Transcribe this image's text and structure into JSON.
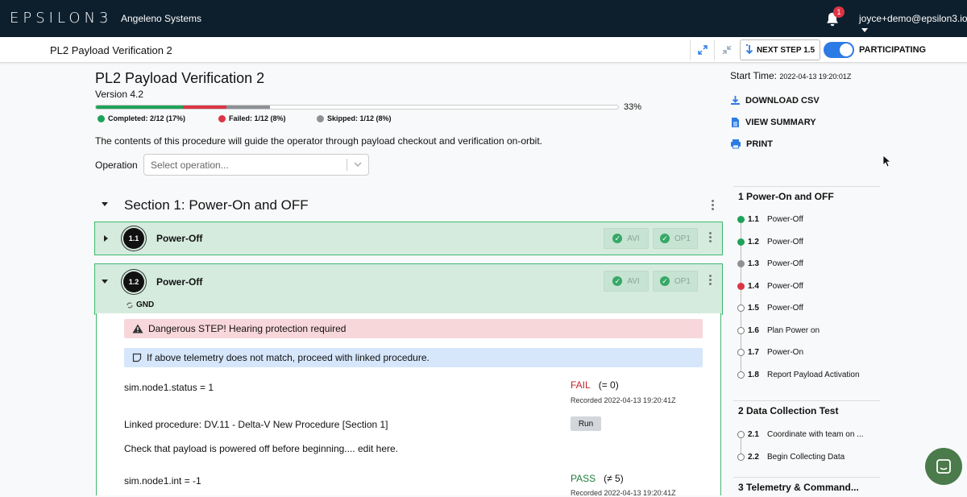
{
  "topbar": {
    "logo": "EPSILON3",
    "org": "Angeleno Systems",
    "notification_count": "1",
    "user": "joyce+demo@epsilon3.io"
  },
  "subbar": {
    "title": "PL2 Payload Verification 2",
    "next_step_label": "NEXT STEP 1.5",
    "participating_label": "PARTICIPATING"
  },
  "procedure": {
    "title": "PL2 Payload Verification 2",
    "version": "Version 4.2",
    "progress": {
      "completed": 2,
      "failed": 1,
      "skipped": 1,
      "total": 12,
      "percent_label": "33%",
      "completed_label": "Completed: 2/12 (17%)",
      "failed_label": "Failed: 1/12 (8%)",
      "skipped_label": "Skipped: 1/12 (8%)"
    },
    "description": "The contents of this procedure will guide the operator through payload checkout and verification on-orbit.",
    "operation_label": "Operation",
    "operation_placeholder": "Select operation..."
  },
  "section": {
    "title": "Section 1: Power-On and OFF",
    "steps": [
      {
        "num": "1.1",
        "name": "Power-Off",
        "signoffs": [
          "AVI",
          "OP1"
        ]
      },
      {
        "num": "1.2",
        "name": "Power-Off",
        "signoffs": [
          "AVI",
          "OP1"
        ],
        "tag": "GND"
      }
    ]
  },
  "step_content": {
    "danger_alert": "Dangerous STEP! Hearing protection required",
    "info_alert": "If above telemetry does not match, proceed with linked procedure.",
    "telemetry_1": {
      "label": "sim.node1.status = 1",
      "status": "FAIL",
      "condition": "(= 0)",
      "recorded": "Recorded 2022-04-13 19:20:41Z"
    },
    "linked_procedure": "Linked procedure: DV.11 - Delta-V New Procedure [Section 1]",
    "run_label": "Run",
    "check_text": "Check that payload is powered off before beginning.... edit here.",
    "telemetry_2": {
      "label": "sim.node1.int = -1",
      "status": "PASS",
      "condition": "(≠ 5)",
      "recorded": "Recorded 2022-04-13 19:20:41Z"
    }
  },
  "sidebar": {
    "start_time_label": "Start Time:",
    "start_time_value": "2022-04-13 19:20:01Z",
    "actions": {
      "download": "DOWNLOAD CSV",
      "summary": "VIEW SUMMARY",
      "print": "PRINT"
    },
    "toc": [
      {
        "title": "1 Power-On and OFF",
        "items": [
          {
            "num": "1.1",
            "label": "Power-Off",
            "state": "completed"
          },
          {
            "num": "1.2",
            "label": "Power-Off",
            "state": "completed"
          },
          {
            "num": "1.3",
            "label": "Power-Off",
            "state": "skipped"
          },
          {
            "num": "1.4",
            "label": "Power-Off",
            "state": "failed"
          },
          {
            "num": "1.5",
            "label": "Power-Off",
            "state": "pending"
          },
          {
            "num": "1.6",
            "label": "Plan Power on",
            "state": "pending"
          },
          {
            "num": "1.7",
            "label": "Power-On",
            "state": "pending"
          },
          {
            "num": "1.8",
            "label": "Report Payload Activation",
            "state": "pending"
          }
        ]
      },
      {
        "title": "2 Data Collection Test",
        "items": [
          {
            "num": "2.1",
            "label": "Coordinate with team on ...",
            "state": "pending"
          },
          {
            "num": "2.2",
            "label": "Begin Collecting Data",
            "state": "pending"
          }
        ]
      },
      {
        "title": "3 Telemetry & Command...",
        "items": []
      }
    ]
  },
  "colors": {
    "completed": "#1fa35a",
    "failed": "#dc3545",
    "skipped": "#8d9196",
    "accent": "#2c7be5",
    "fail_text": "#c0262c",
    "pass_text": "#1e7d3e"
  }
}
